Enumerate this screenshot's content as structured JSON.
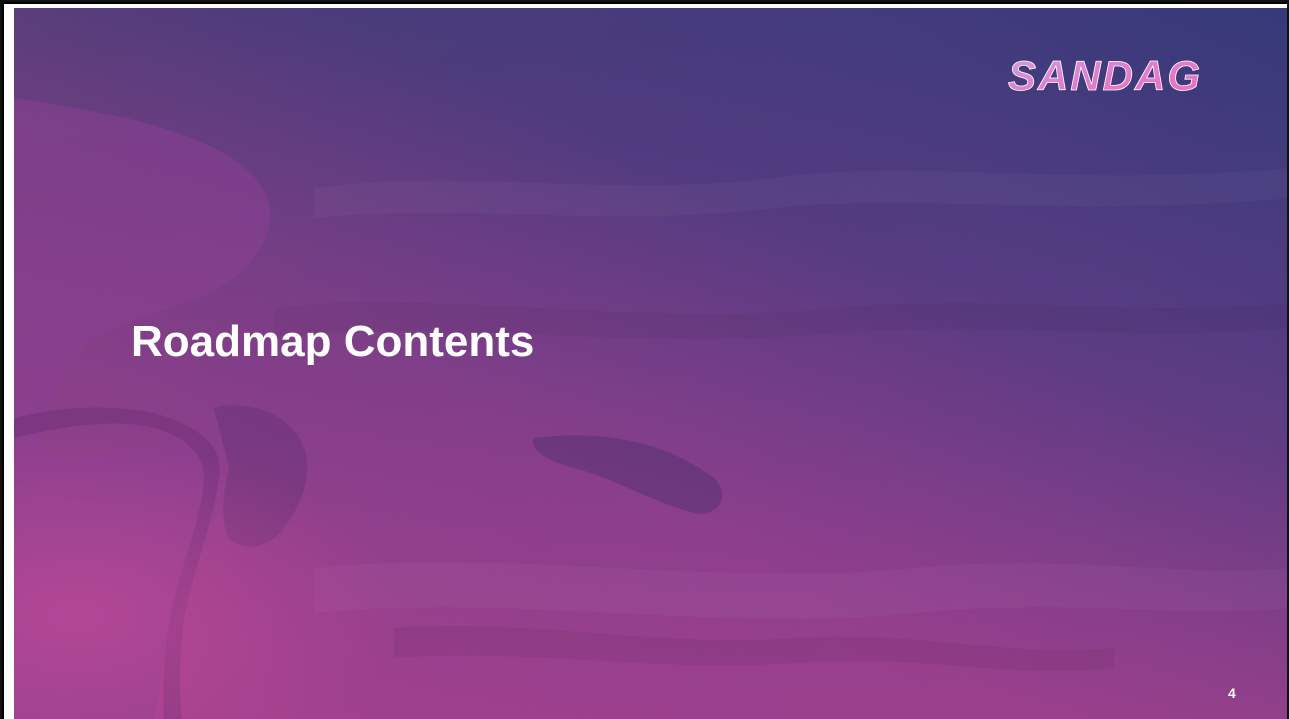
{
  "slide": {
    "title": "Roadmap Contents",
    "page_number": "4",
    "logo": {
      "text": "SANDAG",
      "icon": "sandag-logo-icon"
    },
    "colors": {
      "background_top": "#4b3a78",
      "background_bottom": "#9b3f8c",
      "title_text": "#ffffff",
      "logo_fill_start": "#c6a3e6",
      "logo_fill_end": "#f06ac0"
    }
  }
}
